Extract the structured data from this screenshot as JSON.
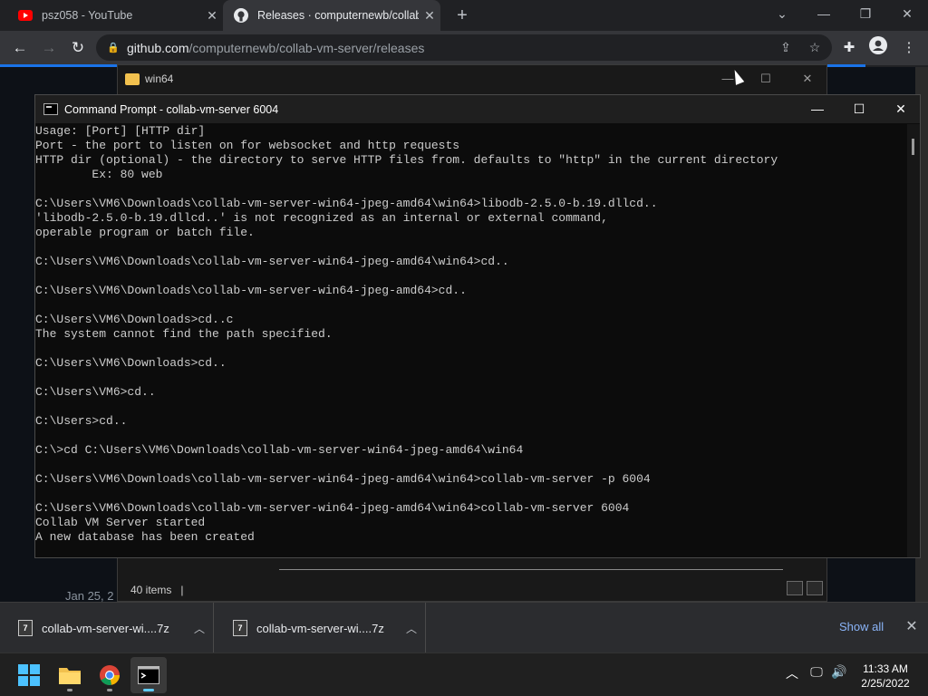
{
  "browser": {
    "tabs": [
      {
        "title": "psz058 - YouTube",
        "favicon": "youtube-icon"
      },
      {
        "title": "Releases · computernewb/collab-vm-server",
        "favicon": "github-icon"
      }
    ],
    "url_host": "github.com",
    "url_path": "/computernewb/collab-vm-server/releases"
  },
  "explorer": {
    "title": "win64",
    "status": "40 items"
  },
  "page": {
    "date_partial": "Jan 25, 2"
  },
  "cmd": {
    "title": "Command Prompt - collab-vm-server  6004",
    "lines": [
      "Usage: [Port] [HTTP dir]",
      "Port - the port to listen on for websocket and http requests",
      "HTTP dir (optional) - the directory to serve HTTP files from. defaults to \"http\" in the current directory",
      "        Ex: 80 web",
      "",
      "C:\\Users\\VM6\\Downloads\\collab-vm-server-win64-jpeg-amd64\\win64>libodb-2.5.0-b.19.dllcd..",
      "'libodb-2.5.0-b.19.dllcd..' is not recognized as an internal or external command,",
      "operable program or batch file.",
      "",
      "C:\\Users\\VM6\\Downloads\\collab-vm-server-win64-jpeg-amd64\\win64>cd..",
      "",
      "C:\\Users\\VM6\\Downloads\\collab-vm-server-win64-jpeg-amd64>cd..",
      "",
      "C:\\Users\\VM6\\Downloads>cd..c",
      "The system cannot find the path specified.",
      "",
      "C:\\Users\\VM6\\Downloads>cd..",
      "",
      "C:\\Users\\VM6>cd..",
      "",
      "C:\\Users>cd..",
      "",
      "C:\\>cd C:\\Users\\VM6\\Downloads\\collab-vm-server-win64-jpeg-amd64\\win64",
      "",
      "C:\\Users\\VM6\\Downloads\\collab-vm-server-win64-jpeg-amd64\\win64>collab-vm-server -p 6004",
      "",
      "C:\\Users\\VM6\\Downloads\\collab-vm-server-win64-jpeg-amd64\\win64>collab-vm-server 6004",
      "Collab VM Server started",
      "A new database has been created"
    ]
  },
  "downloads": {
    "items": [
      {
        "name": "collab-vm-server-wi....7z"
      },
      {
        "name": "collab-vm-server-wi....7z"
      }
    ],
    "show_all": "Show all"
  },
  "taskbar": {
    "time": "11:33 AM",
    "date": "2/25/2022"
  },
  "colors": {
    "chrome_frame": "#202124",
    "chrome_toolbar": "#35363a",
    "link_blue": "#8ab4f8",
    "console_text": "#cccccc"
  }
}
